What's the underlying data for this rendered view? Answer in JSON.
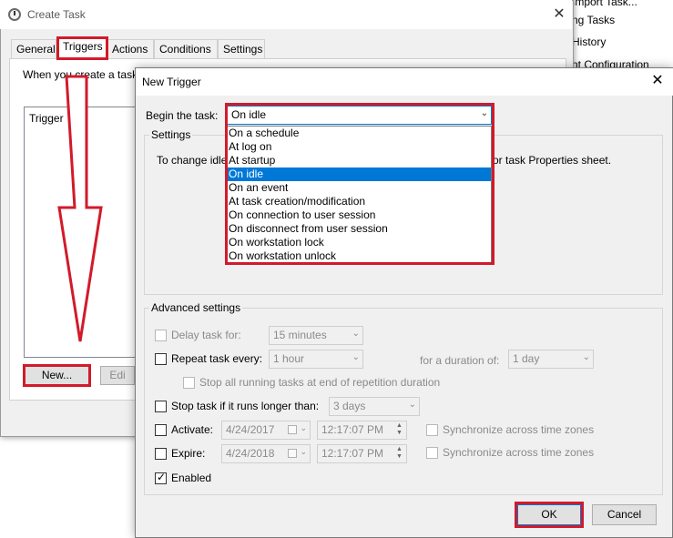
{
  "background_panel": {
    "items": [
      "Import Task...",
      "ng Tasks",
      "History",
      "nt Configuration"
    ]
  },
  "create_task": {
    "title": "Create Task",
    "tabs": [
      "General",
      "Triggers",
      "Actions",
      "Conditions",
      "Settings"
    ],
    "active_tab": "Triggers",
    "description": "When you create a task",
    "list_header": "Trigger",
    "buttons": {
      "new": "New...",
      "edit": "Edi"
    }
  },
  "new_trigger": {
    "title": "New Trigger",
    "begin_label": "Begin the task:",
    "begin_value": "On idle",
    "settings_label": "Settings",
    "settings_text_left": "To change idle",
    "settings_text_right": "or task Properties sheet.",
    "dropdown_options": [
      "On a schedule",
      "At log on",
      "At startup",
      "On idle",
      "On an event",
      "At task creation/modification",
      "On connection to user session",
      "On disconnect from user session",
      "On workstation lock",
      "On workstation unlock"
    ],
    "selected_option_index": 3,
    "advanced": {
      "label": "Advanced settings",
      "delay_label": "Delay task for:",
      "delay_value": "15 minutes",
      "delay_checked": false,
      "repeat_label": "Repeat task every:",
      "repeat_value": "1 hour",
      "repeat_checked": false,
      "duration_label": "for a duration of:",
      "duration_value": "1 day",
      "stop_running_label": "Stop all running tasks at end of repetition duration",
      "stop_if_label": "Stop task if it runs longer than:",
      "stop_if_value": "3 days",
      "stop_if_checked": false,
      "activate_label": "Activate:",
      "activate_date": "4/24/2017",
      "activate_time": "12:17:07 PM",
      "expire_label": "Expire:",
      "expire_date": "4/24/2018",
      "expire_time": "12:17:07 PM",
      "sync_label": "Synchronize across time zones",
      "enabled_label": "Enabled",
      "enabled_checked": true
    },
    "buttons": {
      "ok": "OK",
      "cancel": "Cancel"
    }
  },
  "colors": {
    "highlight": "#d21a2a",
    "selection": "#0078d7",
    "dialog_bg": "#f0f0f0"
  }
}
